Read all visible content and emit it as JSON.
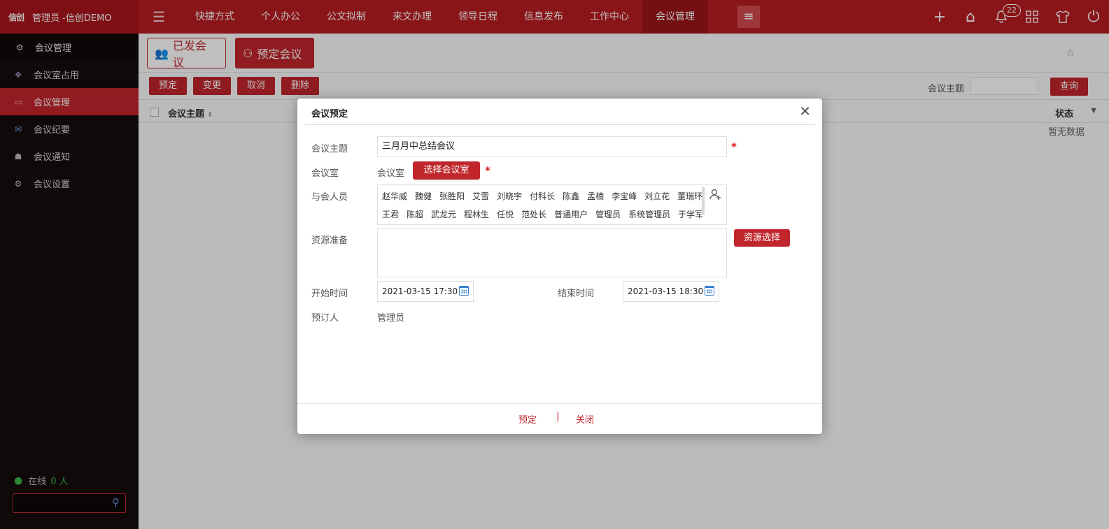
{
  "brand": {
    "logo": "信创",
    "title": "管理员 -信创DEMO"
  },
  "nav": [
    "快捷方式",
    "个人办公",
    "公文拟制",
    "来文办理",
    "领导日程",
    "信息发布",
    "工作中心",
    "会议管理"
  ],
  "notifications": {
    "count": "22"
  },
  "sidebar": {
    "header": "会议管理",
    "items": [
      {
        "label": "会议室占用",
        "icon": "meeting-room-icon"
      },
      {
        "label": "会议管理",
        "icon": "meeting-icon"
      },
      {
        "label": "会议纪要",
        "icon": "minutes-icon"
      },
      {
        "label": "会议通知",
        "icon": "notice-icon"
      },
      {
        "label": "会议设置",
        "icon": "settings-icon"
      }
    ],
    "online_label": "在线",
    "online_count": "0 人"
  },
  "tabs": {
    "sent": "已发会议",
    "book": "预定会议"
  },
  "toolbar": {
    "book": "预定",
    "change": "变更",
    "cancel": "取消",
    "delete": "删除",
    "search_label": "会议主题",
    "query": "查询"
  },
  "table": {
    "col_subject": "会议主题",
    "col_status": "状态",
    "empty": "暂无数据"
  },
  "modal": {
    "title": "会议预定",
    "subject_label": "会议主题",
    "subject_value": "三月月中总结会议",
    "room_label": "会议室",
    "room_value": "会议室",
    "room_button": "选择会议室",
    "attendees_label": "与会人员",
    "attendees_row1": [
      "赵华威",
      "魏健",
      "张胜阳",
      "艾雪",
      "刘晓宇",
      "付科长",
      "陈鑫",
      "孟楠",
      "李宝峰",
      "刘立花",
      "董瑞环"
    ],
    "attendees_row2": [
      "王君",
      "陈超",
      "武龙元",
      "程林生",
      "任悦",
      "范处长",
      "普通用户",
      "管理员",
      "系统管理员",
      "于学军"
    ],
    "resource_label": "资源准备",
    "resource_button": "资源选择",
    "start_label": "开始时间",
    "start_value": "2021-03-15 17:30",
    "end_label": "结束时间",
    "end_value": "2021-03-15 18:30",
    "booker_label": "预订人",
    "booker_value": "管理员",
    "footer_book": "预定",
    "footer_sep": "|",
    "footer_close": "关闭",
    "required_mark": "*"
  }
}
